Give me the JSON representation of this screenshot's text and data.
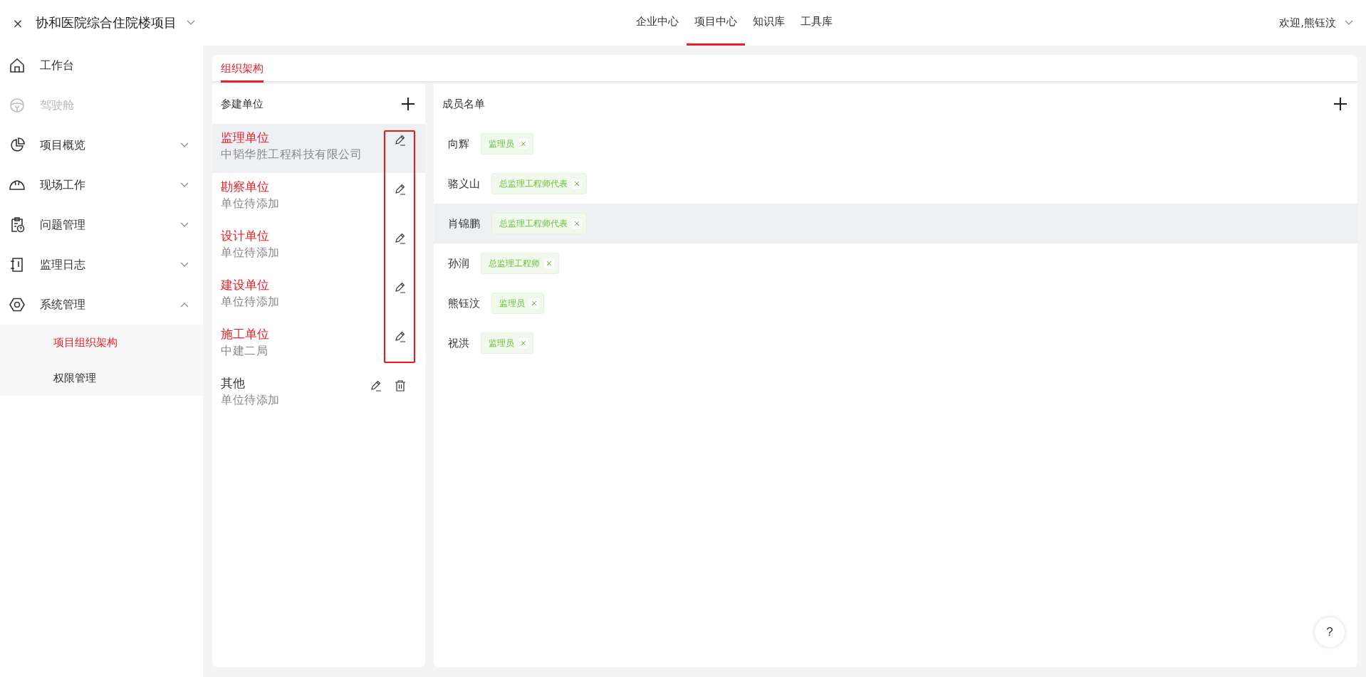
{
  "header": {
    "close": "×",
    "project": "协和医院综合住院楼项目",
    "nav": [
      {
        "label": "企业中心",
        "selected": false
      },
      {
        "label": "项目中心",
        "selected": true
      },
      {
        "label": "知识库",
        "selected": false
      },
      {
        "label": "工具库",
        "selected": false
      }
    ],
    "welcome": "欢迎,熊钰汶"
  },
  "sidebar": {
    "items": [
      {
        "label": "工作台",
        "disabled": false
      },
      {
        "label": "驾驶舱",
        "disabled": true
      },
      {
        "label": "项目概览",
        "disabled": false,
        "expanded": false
      },
      {
        "label": "现场工作",
        "disabled": false,
        "expanded": false
      },
      {
        "label": "问题管理",
        "disabled": false,
        "expanded": false
      },
      {
        "label": "监理日志",
        "disabled": false,
        "expanded": false
      },
      {
        "label": "系统管理",
        "disabled": false,
        "expanded": true,
        "children": [
          {
            "label": "项目组织架构",
            "selected": true
          },
          {
            "label": "权限管理",
            "selected": false
          }
        ]
      }
    ]
  },
  "tabs": [
    {
      "label": "组织架构",
      "selected": true
    }
  ],
  "units_panel": {
    "title": "参建单位",
    "units": [
      {
        "kind": "fixed",
        "name": "监理单位",
        "org": "中韬华胜工程科技有限公司",
        "selected": true,
        "annotated": true
      },
      {
        "kind": "fixed",
        "name": "勘察单位",
        "org": "单位待添加",
        "selected": false,
        "annotated": true
      },
      {
        "kind": "fixed",
        "name": "设计单位",
        "org": "单位待添加",
        "selected": false,
        "annotated": true
      },
      {
        "kind": "fixed",
        "name": "建设单位",
        "org": "单位待添加",
        "selected": false,
        "annotated": true
      },
      {
        "kind": "fixed",
        "name": "施工单位",
        "org": "中建二局",
        "selected": false,
        "annotated": true
      },
      {
        "kind": "custom",
        "name": "其他",
        "org": "单位待添加",
        "selected": false,
        "annotated": false
      }
    ]
  },
  "members_panel": {
    "title": "成员名单",
    "members": [
      {
        "name": "向辉",
        "role": "监理员",
        "highlighted": false
      },
      {
        "name": "骆义山",
        "role": "总监理工程师代表",
        "highlighted": false
      },
      {
        "name": "肖锦鹏",
        "role": "总监理工程师代表",
        "highlighted": true
      },
      {
        "name": "孙润",
        "role": "总监理工程师",
        "highlighted": false
      },
      {
        "name": "熊钰汶",
        "role": "监理员",
        "highlighted": false
      },
      {
        "name": "祝洪",
        "role": "监理员",
        "highlighted": false
      }
    ]
  },
  "help": "?"
}
